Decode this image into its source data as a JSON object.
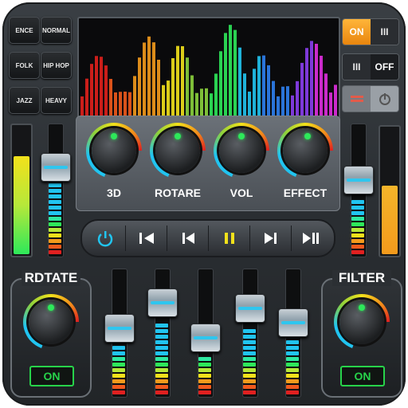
{
  "presets": [
    {
      "label": "ENCE"
    },
    {
      "label": "NORMAL"
    },
    {
      "label": "FOLK"
    },
    {
      "label": "HIP HOP"
    },
    {
      "label": "JAZZ"
    },
    {
      "label": "HEAVY"
    }
  ],
  "toggles": {
    "power_on_label": "ON",
    "power_bars_label": "III",
    "bars_label": "III",
    "off_label": "OFF"
  },
  "knobs": [
    {
      "label": "3D"
    },
    {
      "label": "ROTARE"
    },
    {
      "label": "VOL"
    },
    {
      "label": "EFFECT"
    }
  ],
  "transport": {
    "power_icon": "power-icon",
    "skip_back_icon": "skip-to-start-icon",
    "prev_icon": "previous-icon",
    "pause_icon": "pause-icon",
    "next_icon": "next-icon",
    "play_pause_icon": "play-pause-icon"
  },
  "left_panel": {
    "title": "RDTATE",
    "button": "ON"
  },
  "right_panel": {
    "title": "FILTER",
    "button": "ON"
  },
  "eq_levels": [
    0.55,
    0.8,
    0.45,
    0.75,
    0.6
  ],
  "left_slider_level": 0.72,
  "right_slider_level": 0.6,
  "left_meter_level": 0.78,
  "right_meter_level": 0.55,
  "colors": {
    "accent": "#21c4f0",
    "on_green": "#27d34a",
    "power_orange": "#f39a1c"
  }
}
